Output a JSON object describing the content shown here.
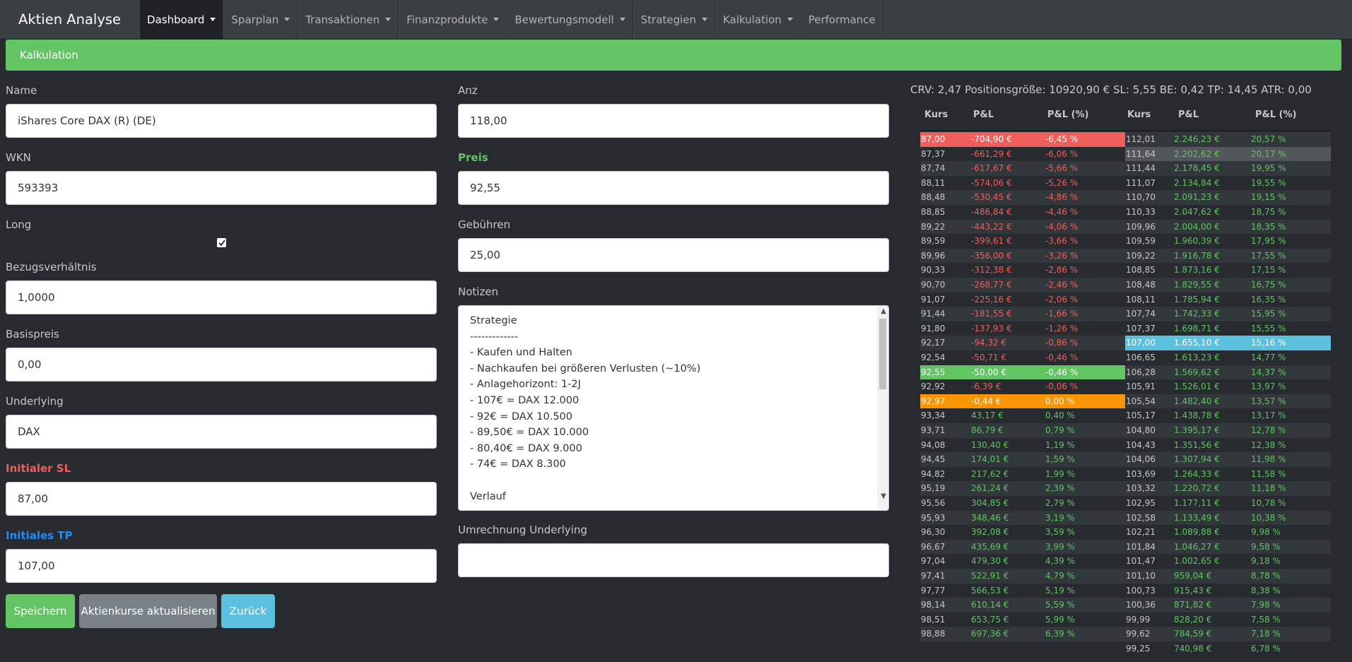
{
  "app": {
    "brand": "Aktien Analyse"
  },
  "nav": [
    {
      "label": "Dashboard",
      "active": true,
      "caret": true
    },
    {
      "label": "Sparplan",
      "caret": true
    },
    {
      "label": "Transaktionen",
      "caret": true
    },
    {
      "label": "Finanzprodukte",
      "caret": true
    },
    {
      "label": "Bewertungsmodell",
      "caret": true
    },
    {
      "label": "Strategien",
      "caret": true
    },
    {
      "label": "Kalkulation",
      "caret": true
    },
    {
      "label": "Performance",
      "caret": false
    }
  ],
  "alert": "Kalkulation",
  "form": {
    "name_label": "Name",
    "name_value": "iShares Core DAX (R) (DE)",
    "wkn_label": "WKN",
    "wkn_value": "593393",
    "long_label": "Long",
    "long_checked": true,
    "bezug_label": "Bezugsverhältnis",
    "bezug_value": "1,0000",
    "basis_label": "Basispreis",
    "basis_value": "0,00",
    "underlying_label": "Underlying",
    "underlying_value": "DAX",
    "sl_label": "Initialer SL",
    "sl_value": "87,00",
    "tp_label": "Initiales TP",
    "tp_value": "107,00",
    "anz_label": "Anz",
    "anz_value": "118,00",
    "preis_label": "Preis",
    "preis_value": "92,55",
    "gebuehren_label": "Gebühren",
    "gebuehren_value": "25,00",
    "notizen_label": "Notizen",
    "notizen_lines": [
      "Strategie",
      "-------------",
      "- Kaufen und Halten",
      "- Nachkaufen bei größeren Verlusten (~10%)",
      "- Anlagehorizont: 1-2J",
      "- 107€ = DAX 12.000",
      "- 92€ = DAX 10.500",
      "- 89,50€ = DAX 10.000",
      "- 80,40€ = DAX 9.000",
      "- 74€ = DAX 8.300",
      "",
      "Verlauf"
    ],
    "umrechnung_label": "Umrechnung Underlying",
    "umrechnung_value": ""
  },
  "buttons": {
    "save": "Speichern",
    "update": "Aktienkurse aktualisieren",
    "back": "Zurück"
  },
  "summary": "CRV: 2,47 Positionsgröße: 10920,90 € SL: 5,55 BE: 0,42 TP: 14,45 ATR: 0,00",
  "table": {
    "headers": [
      "Kurs",
      "P&L",
      "P&L (%)",
      "Kurs",
      "P&L",
      "P&L (%)"
    ],
    "left": [
      [
        "87,00",
        "-704,90 €",
        "-6,45 %",
        "red"
      ],
      [
        "87,37",
        "-661,29 €",
        "-6,06 %",
        ""
      ],
      [
        "87,74",
        "-617,67 €",
        "-5,66 %",
        ""
      ],
      [
        "88,11",
        "-574,06 €",
        "-5,26 %",
        ""
      ],
      [
        "88,48",
        "-530,45 €",
        "-4,86 %",
        ""
      ],
      [
        "88,85",
        "-486,84 €",
        "-4,46 %",
        ""
      ],
      [
        "89,22",
        "-443,22 €",
        "-4,06 %",
        ""
      ],
      [
        "89,59",
        "-399,61 €",
        "-3,66 %",
        ""
      ],
      [
        "89,96",
        "-356,00 €",
        "-3,26 %",
        ""
      ],
      [
        "90,33",
        "-312,38 €",
        "-2,86 %",
        ""
      ],
      [
        "90,70",
        "-268,77 €",
        "-2,46 %",
        ""
      ],
      [
        "91,07",
        "-225,16 €",
        "-2,06 %",
        ""
      ],
      [
        "91,44",
        "-181,55 €",
        "-1,66 %",
        ""
      ],
      [
        "91,80",
        "-137,93 €",
        "-1,26 %",
        ""
      ],
      [
        "92,17",
        "-94,32 €",
        "-0,86 %",
        ""
      ],
      [
        "92,54",
        "-50,71 €",
        "-0,46 %",
        ""
      ],
      [
        "92,55",
        "-50,00 €",
        "-0,46 %",
        "green"
      ],
      [
        "92,92",
        "-6,39 €",
        "-0,06 %",
        ""
      ],
      [
        "92,97",
        "-0,44 €",
        "0,00 %",
        "orange"
      ],
      [
        "93,34",
        "43,17 €",
        "0,40 %",
        ""
      ],
      [
        "93,71",
        "86,79 €",
        "0,79 %",
        ""
      ],
      [
        "94,08",
        "130,40 €",
        "1,19 %",
        ""
      ],
      [
        "94,45",
        "174,01 €",
        "1,59 %",
        ""
      ],
      [
        "94,82",
        "217,62 €",
        "1,99 %",
        ""
      ],
      [
        "95,19",
        "261,24 €",
        "2,39 %",
        ""
      ],
      [
        "95,56",
        "304,85 €",
        "2,79 %",
        ""
      ],
      [
        "95,93",
        "348,46 €",
        "3,19 %",
        ""
      ],
      [
        "96,30",
        "392,08 €",
        "3,59 %",
        ""
      ],
      [
        "96,67",
        "435,69 €",
        "3,99 %",
        ""
      ],
      [
        "97,04",
        "479,30 €",
        "4,39 %",
        ""
      ],
      [
        "97,41",
        "522,91 €",
        "4,79 %",
        ""
      ],
      [
        "97,77",
        "566,53 €",
        "5,19 %",
        ""
      ],
      [
        "98,14",
        "610,14 €",
        "5,59 %",
        ""
      ],
      [
        "98,51",
        "653,75 €",
        "5,99 %",
        ""
      ],
      [
        "98,88",
        "697,36 €",
        "6,39 %",
        ""
      ]
    ],
    "right": [
      [
        "112,01",
        "2.246,23 €",
        "20,57 %",
        ""
      ],
      [
        "111,64",
        "2.202,62 €",
        "20,17 %",
        "gray"
      ],
      [
        "111,44",
        "2.178,45 €",
        "19,95 %",
        ""
      ],
      [
        "111,07",
        "2.134,84 €",
        "19,55 %",
        ""
      ],
      [
        "110,70",
        "2.091,23 €",
        "19,15 %",
        ""
      ],
      [
        "110,33",
        "2.047,62 €",
        "18,75 %",
        ""
      ],
      [
        "109,96",
        "2.004,00 €",
        "18,35 %",
        ""
      ],
      [
        "109,59",
        "1.960,39 €",
        "17,95 %",
        ""
      ],
      [
        "109,22",
        "1.916,78 €",
        "17,55 %",
        ""
      ],
      [
        "108,85",
        "1.873,16 €",
        "17,15 %",
        ""
      ],
      [
        "108,48",
        "1.829,55 €",
        "16,75 %",
        ""
      ],
      [
        "108,11",
        "1.785,94 €",
        "16,35 %",
        ""
      ],
      [
        "107,74",
        "1.742,33 €",
        "15,95 %",
        ""
      ],
      [
        "107,37",
        "1.698,71 €",
        "15,55 %",
        ""
      ],
      [
        "107,00",
        "1.655,10 €",
        "15,16 %",
        "blue"
      ],
      [
        "106,65",
        "1.613,23 €",
        "14,77 %",
        ""
      ],
      [
        "106,28",
        "1.569,62 €",
        "14,37 %",
        ""
      ],
      [
        "105,91",
        "1.526,01 €",
        "13,97 %",
        ""
      ],
      [
        "105,54",
        "1.482,40 €",
        "13,57 %",
        ""
      ],
      [
        "105,17",
        "1.438,78 €",
        "13,17 %",
        ""
      ],
      [
        "104,80",
        "1.395,17 €",
        "12,78 %",
        ""
      ],
      [
        "104,43",
        "1.351,56 €",
        "12,38 %",
        ""
      ],
      [
        "104,06",
        "1.307,94 €",
        "11,98 %",
        ""
      ],
      [
        "103,69",
        "1.264,33 €",
        "11,58 %",
        ""
      ],
      [
        "103,32",
        "1.220,72 €",
        "11,18 %",
        ""
      ],
      [
        "102,95",
        "1.177,11 €",
        "10,78 %",
        ""
      ],
      [
        "102,58",
        "1.133,49 €",
        "10,38 %",
        ""
      ],
      [
        "102,21",
        "1.089,88 €",
        "9,98 %",
        ""
      ],
      [
        "101,84",
        "1.046,27 €",
        "9,58 %",
        ""
      ],
      [
        "101,47",
        "1.002,65 €",
        "9,18 %",
        ""
      ],
      [
        "101,10",
        "959,04 €",
        "8,78 %",
        ""
      ],
      [
        "100,73",
        "915,43 €",
        "8,38 %",
        ""
      ],
      [
        "100,36",
        "871,82 €",
        "7,98 %",
        ""
      ],
      [
        "99,99",
        "828,20 €",
        "7,58 %",
        ""
      ],
      [
        "99,62",
        "784,59 €",
        "7,18 %",
        ""
      ],
      [
        "99,25",
        "740,98 €",
        "6,78 %",
        ""
      ]
    ]
  },
  "colors": {
    "bg": "#272b30",
    "nav": "#3a3f44",
    "success": "#62c462",
    "danger": "#ee5f5b",
    "warning": "#f89406",
    "info": "#5bc0de",
    "secondary": "#7a8288",
    "primary": "#1b8dff"
  }
}
